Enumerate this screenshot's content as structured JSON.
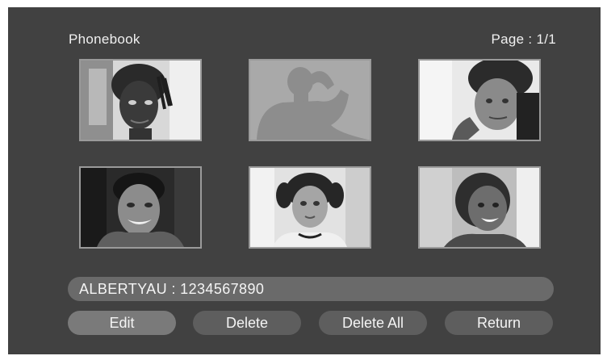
{
  "header": {
    "title": "Phonebook",
    "page_label": "Page : 1/1"
  },
  "contacts": [
    {
      "photo": "contact-photo-woman-dreadlocks"
    },
    {
      "photo": "default-silhouette-placeholder"
    },
    {
      "photo": "contact-photo-man-on-phone"
    },
    {
      "photo": "contact-photo-man-smiling"
    },
    {
      "photo": "contact-photo-woman-pigtails"
    },
    {
      "photo": "contact-photo-woman-smiling"
    }
  ],
  "selected": {
    "text": "ALBERTYAU : 1234567890"
  },
  "buttons": {
    "edit": "Edit",
    "delete": "Delete",
    "delete_all": "Delete All",
    "return": "Return"
  },
  "colors": {
    "background": "#414141",
    "bar": "#6a6a6a",
    "button": "#5e5e5e",
    "button_active": "#7a7a7a",
    "text": "#f0f0f0"
  }
}
